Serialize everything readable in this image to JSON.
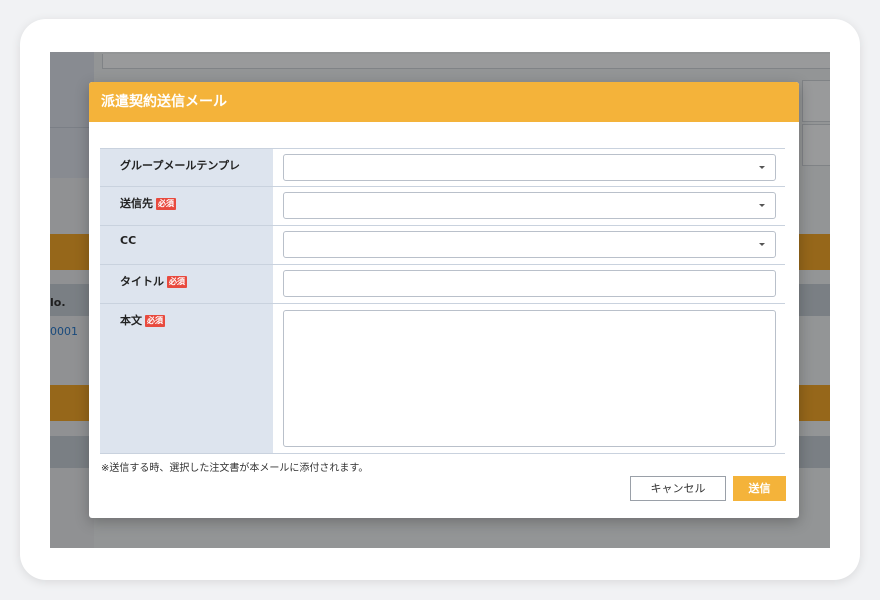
{
  "background": {
    "table_header_fragment": "lo.",
    "row_link_fragment": "0001"
  },
  "modal": {
    "title": "派遣契約送信メール",
    "required_badge": "必須",
    "fields": [
      {
        "label": "グループメールテンプレ",
        "type": "select",
        "required": false,
        "value": ""
      },
      {
        "label": "送信先",
        "type": "select",
        "required": true,
        "value": ""
      },
      {
        "label": "CC",
        "type": "select",
        "required": false,
        "value": ""
      },
      {
        "label": "タイトル",
        "type": "text",
        "required": true,
        "value": ""
      },
      {
        "label": "本文",
        "type": "textarea",
        "required": true,
        "value": ""
      }
    ],
    "note": "※送信する時、選択した注文書が本メールに添付されます。",
    "cancel_label": "キャンセル",
    "send_label": "送信"
  },
  "colors": {
    "header_orange": "#f4b33a",
    "label_bg": "#dde4ee",
    "required_red": "#e84a3e"
  },
  "icons": [
    "chevron-down-icon"
  ]
}
